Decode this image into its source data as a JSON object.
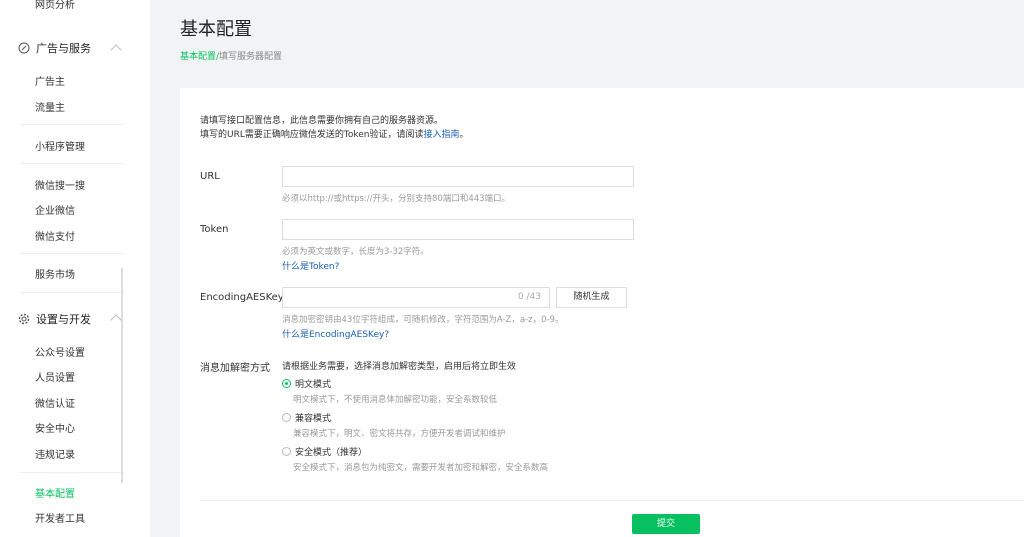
{
  "sidebar": {
    "top_cut_item": "网页分析",
    "section_ads": {
      "label": "广告与服务",
      "icon": "circle-slash-icon"
    },
    "ads_items": [
      "广告主",
      "流量主"
    ],
    "miniprogram": "小程序管理",
    "group2": [
      "微信搜一搜",
      "企业微信",
      "微信支付"
    ],
    "market": "服务市场",
    "section_dev": {
      "label": "设置与开发",
      "icon": "gear-icon"
    },
    "dev_items": [
      "公众号设置",
      "人员设置",
      "微信认证",
      "安全中心",
      "违规记录"
    ],
    "basic_config": "基本配置",
    "dev_tools": "开发者工具"
  },
  "header": {
    "title": "基本配置",
    "breadcrumb_current": "基本配置/",
    "breadcrumb_next": " 填写服务器配置"
  },
  "intro": {
    "line1": "请填写接口配置信息，此信息需要你拥有自己的服务器资源。",
    "line2_prefix": "填写的URL需要正确响应微信发送的Token验证，请阅读",
    "line2_link": "接入指南",
    "line2_suffix": "。"
  },
  "url": {
    "label": "URL",
    "value": "",
    "hint": "必须以http://或https://开头，分别支持80端口和443端口。"
  },
  "token": {
    "label": "Token",
    "value": "",
    "hint": "必须为英文或数字，长度为3-32字符。",
    "link": "什么是Token?"
  },
  "aes": {
    "label": "EncodingAESKey",
    "value": "",
    "count": "0 /43",
    "gen_button": "随机生成",
    "hint": "消息加密密钥由43位字符组成，可随机修改，字符范围为A-Z，a-z，0-9。",
    "link": "什么是EncodingAESKey?"
  },
  "encryption": {
    "label": "消息加解密方式",
    "desc": "请根据业务需要，选择消息加解密类型，启用后将立即生效",
    "options": [
      {
        "label": "明文模式",
        "desc": "明文模式下，不使用消息体加解密功能，安全系数较低",
        "selected": true
      },
      {
        "label": "兼容模式",
        "desc": "兼容模式下，明文、密文将共存，方便开发者调试和维护",
        "selected": false
      },
      {
        "label": "安全模式（推荐）",
        "desc": "安全模式下，消息包为纯密文，需要开发者加密和解密，安全系数高",
        "selected": false
      }
    ]
  },
  "submit_label": "提交",
  "colors": {
    "accent": "#07c160",
    "link": "#1a5fb4"
  }
}
